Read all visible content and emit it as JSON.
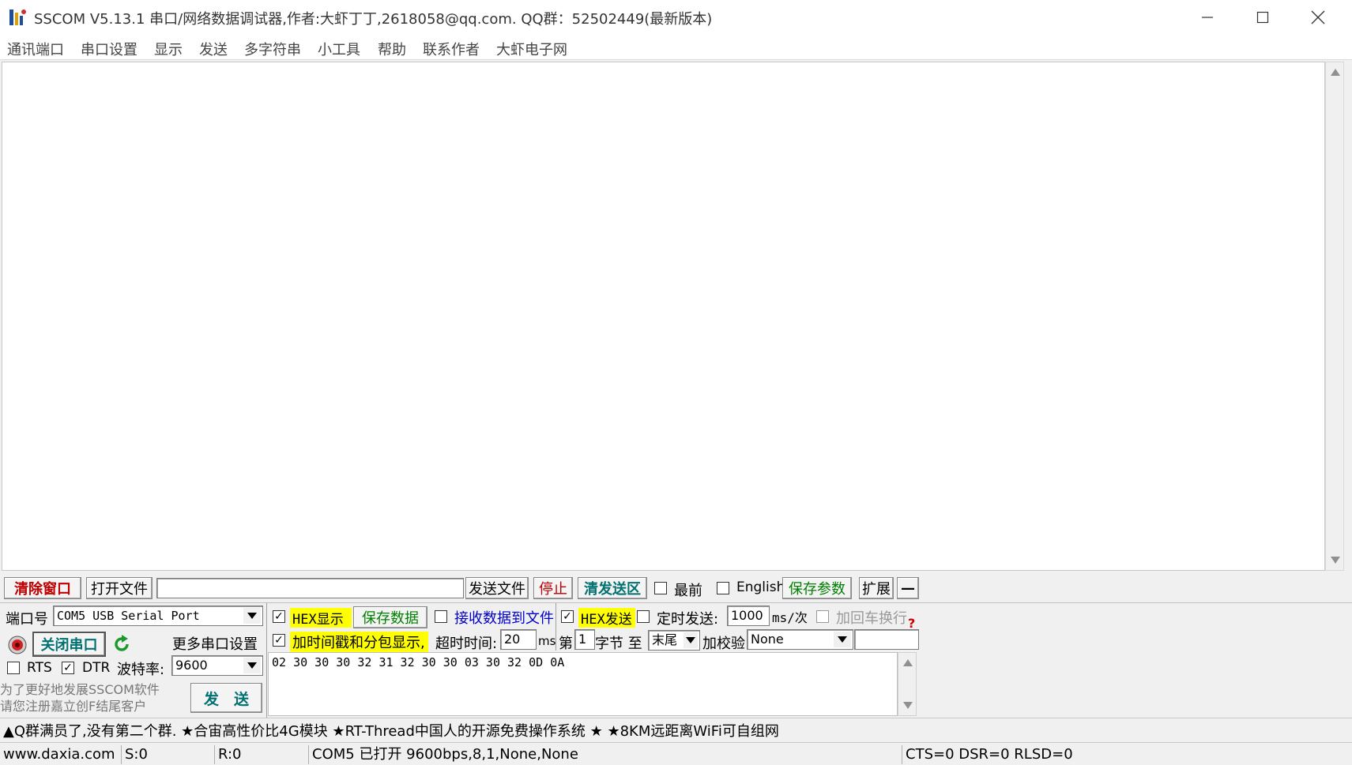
{
  "window": {
    "title": "SSCOM V5.13.1 串口/网络数据调试器,作者:大虾丁丁,2618058@qq.com. QQ群：52502449(最新版本)",
    "icon": "sscom-app-icon",
    "controls": [
      "minimize-icon",
      "maximize-icon",
      "close-icon"
    ]
  },
  "menu": {
    "items": [
      "通讯端口",
      "串口设置",
      "显示",
      "发送",
      "多字符串",
      "小工具",
      "帮助",
      "联系作者",
      "大虾电子网"
    ]
  },
  "receive": {
    "content": ""
  },
  "toolbar": {
    "clear_window": "清除窗口",
    "open_file": "打开文件",
    "file_path": "",
    "send_file": "发送文件",
    "stop": "停止",
    "clear_send": "清发送区",
    "topmost_label": "最前",
    "topmost_checked": false,
    "english_label": "English",
    "english_checked": false,
    "save_params": "保存参数",
    "expand": "扩展",
    "collapse": "—"
  },
  "port": {
    "port_label": "端口号",
    "port_value": "COM5 USB Serial Port",
    "close_port": "关闭串口",
    "more_settings": "更多串口设置",
    "rts_label": "RTS",
    "rts_checked": false,
    "dtr_label": "DTR",
    "dtr_checked": true,
    "baud_label": "波特率:",
    "baud_value": "9600",
    "promo_line1": "为了更好地发展SSCOM软件",
    "promo_line2": "请您注册嘉立创F结尾客户",
    "send_button": "发　送"
  },
  "options": {
    "hex_display_label": "HEX显示",
    "hex_display_checked": true,
    "save_data": "保存数据",
    "recv_to_file_label": "接收数据到文件",
    "recv_to_file_checked": false,
    "hex_send_label": "HEX发送",
    "hex_send_checked": true,
    "timed_send_label": "定时发送:",
    "timed_send_checked": false,
    "interval_value": "1000",
    "interval_unit": "ms/次",
    "crlf_label": "加回车换行",
    "crlf_checked": false,
    "timestamp_label": "加时间戳和分包显示,",
    "timestamp_checked": true,
    "timeout_label": "超时时间:",
    "timeout_value": "20",
    "timeout_unit": "ms",
    "byte_from_label": "第",
    "byte_from_value": "1",
    "byte_unit": "字节 至",
    "byte_to_value": "末尾",
    "checksum_label": "加校验",
    "checksum_value": "None",
    "checksum_extra": ""
  },
  "send": {
    "content": "02 30 30 30 32 31 32 30 30 03 30 32 0D 0A"
  },
  "ticker": {
    "text": "▲Q群满员了,没有第二个群. ★合宙高性价比4G模块 ★RT-Thread中国人的开源免费操作系统 ★ ★8KM远距离WiFi可自组网"
  },
  "status": {
    "website": "www.daxia.com",
    "sent": "S:0",
    "received": "R:0",
    "port_state": "COM5 已打开  9600bps,8,1,None,None",
    "lines": "CTS=0 DSR=0 RLSD=0"
  },
  "colors": {
    "red_text": "#c00000",
    "teal_text": "#007070",
    "green_text": "#008000",
    "highlight": "#ffff00",
    "link_blue": "#0000cc"
  }
}
